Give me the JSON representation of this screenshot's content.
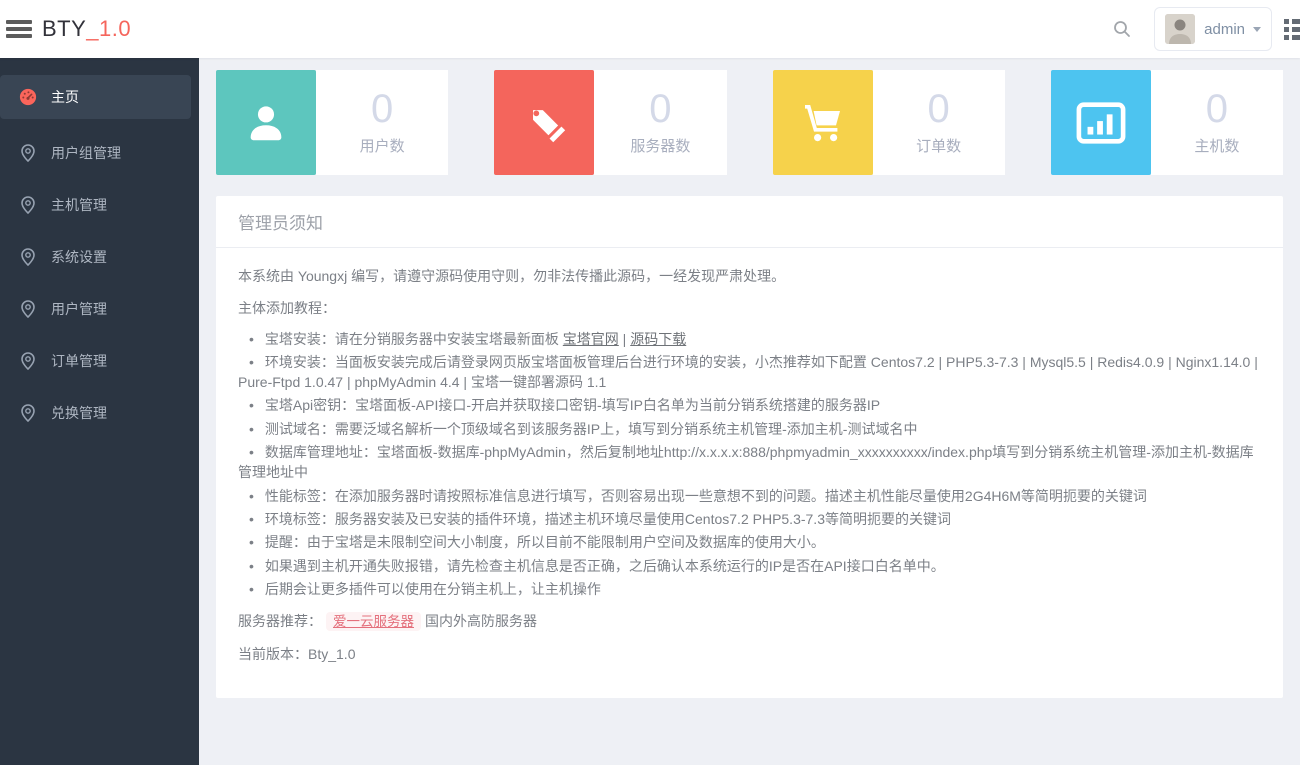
{
  "colors": {
    "logo_accent": "#f5655c",
    "sidebar_bg": "#2b3542",
    "page_bg": "#eef0f5"
  },
  "header": {
    "logo_primary": "BTY",
    "logo_suffix": "_1.0",
    "user_name": "admin"
  },
  "sidebar": {
    "items": [
      {
        "label": "主页",
        "active": true
      },
      {
        "label": "用户组管理",
        "active": false
      },
      {
        "label": "主机管理",
        "active": false
      },
      {
        "label": "系统设置",
        "active": false
      },
      {
        "label": "用户管理",
        "active": false
      },
      {
        "label": "订单管理",
        "active": false
      },
      {
        "label": "兑换管理",
        "active": false
      }
    ]
  },
  "cards": [
    {
      "value": "0",
      "label": "用户数",
      "icon": "user-icon",
      "color": "#5dc6be"
    },
    {
      "value": "0",
      "label": "服务器数",
      "icon": "tags-icon",
      "color": "#f4655c"
    },
    {
      "value": "0",
      "label": "订单数",
      "icon": "cart-icon",
      "color": "#f6d24b"
    },
    {
      "value": "0",
      "label": "主机数",
      "icon": "bar-chart-icon",
      "color": "#4dc4f0"
    }
  ],
  "notice": {
    "title": "管理员须知",
    "intro": "本系统由 Youngxj 编写，请遵守源码使用守则，勿非法传播此源码，一经发现严肃处理。",
    "subtitle": "主体添加教程：",
    "items": [
      {
        "segments": [
          {
            "text": "宝塔安装：请在分销服务器中安装宝塔最新面板 "
          },
          {
            "text": "宝塔官网",
            "link": true
          },
          {
            "text": " | "
          },
          {
            "text": "源码下载",
            "link": true
          }
        ]
      },
      {
        "segments": [
          {
            "text": "环境安装：当面板安装完成后请登录网页版宝塔面板管理后台进行环境的安装，小杰推荐如下配置 Centos7.2 | PHP5.3-7.3 | Mysql5.5 | Redis4.0.9 | Nginx1.14.0 | Pure-Ftpd 1.0.47 | phpMyAdmin 4.4 | 宝塔一键部署源码 1.1"
          }
        ]
      },
      {
        "segments": [
          {
            "text": "宝塔Api密钥：宝塔面板-API接口-开启并获取接口密钥-填写IP白名单为当前分销系统搭建的服务器IP"
          }
        ]
      },
      {
        "segments": [
          {
            "text": "测试域名：需要泛域名解析一个顶级域名到该服务器IP上，填写到分销系统主机管理-添加主机-测试域名中"
          }
        ]
      },
      {
        "segments": [
          {
            "text": "数据库管理地址：宝塔面板-数据库-phpMyAdmin，然后复制地址http://x.x.x.x:888/phpmyadmin_xxxxxxxxxx/index.php填写到分销系统主机管理-添加主机-数据库管理地址中"
          }
        ]
      },
      {
        "segments": [
          {
            "text": "性能标签：在添加服务器时请按照标准信息进行填写，否则容易出现一些意想不到的问题。描述主机性能尽量使用2G4H6M等简明扼要的关键词"
          }
        ]
      },
      {
        "segments": [
          {
            "text": "环境标签：服务器安装及已安装的插件环境，描述主机环境尽量使用Centos7.2 PHP5.3-7.3等简明扼要的关键词"
          }
        ]
      },
      {
        "segments": [
          {
            "text": "提醒：由于宝塔是未限制空间大小制度，所以目前不能限制用户空间及数据库的使用大小。"
          }
        ]
      },
      {
        "segments": [
          {
            "text": "如果遇到主机开通失败报错，请先检查主机信息是否正确，之后确认本系统运行的IP是否在API接口白名单中。"
          }
        ]
      },
      {
        "segments": [
          {
            "text": "后期会让更多插件可以使用在分销主机上，让主机操作"
          }
        ]
      }
    ],
    "footer_recommend": {
      "prefix": "服务器推荐：",
      "badge": "爱一云服务器",
      "suffix": "国内外高防服务器"
    },
    "version_line": {
      "prefix": "当前版本：",
      "value": "Bty_1.0"
    }
  }
}
